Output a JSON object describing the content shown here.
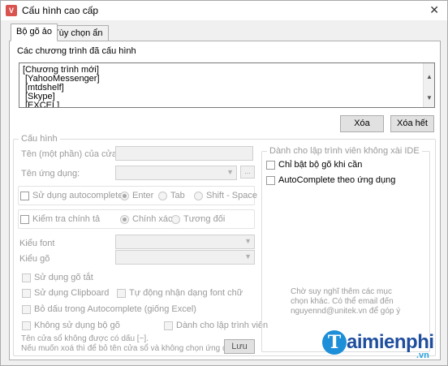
{
  "window": {
    "title": "Cấu hình cao cấp",
    "close_symbol": "✕"
  },
  "tabs": [
    {
      "label": "Bộ gõ ảo",
      "active": true
    },
    {
      "label": "Tùy chọn ẩn",
      "active": false
    }
  ],
  "programs": {
    "label": "Các chương trình đã cấu hình",
    "items": [
      "[Chương trình mới]",
      "[YahooMessenger]",
      "[mtdshelf]",
      "[Skype]",
      "[EXCEL]"
    ],
    "delete_label": "Xóa",
    "delete_all_label": "Xóa hết"
  },
  "config": {
    "group_label": "Cấu hình",
    "window_name_label": "Tên (một phần) của cửa sổ:",
    "window_name_value": "",
    "app_name_label": "Tên ứng dụng:",
    "app_name_value": "",
    "browse_label": "...",
    "use_autocomplete_label": "Sử dụng autocomplete",
    "autocomplete_options": [
      "Enter",
      "Tab",
      "Shift - Space"
    ],
    "autocomplete_selected": "Enter",
    "spellcheck_label": "Kiểm tra chính tả",
    "spellcheck_options": [
      "Chính xác",
      "Tương đối"
    ],
    "spellcheck_selected": "Chính xác",
    "font_type_label": "Kiểu font",
    "font_type_value": "",
    "input_type_label": "Kiểu gõ",
    "input_type_value": "",
    "use_shortcut_label": "Sử dụng gõ tắt",
    "use_clipboard_label": "Sử dụng Clipboard",
    "auto_font_detect_label": "Tự động nhận dạng font chữ",
    "remove_accent_label": "Bỏ dấu trong Autocomplete (giống Excel)",
    "no_ime_label": "Không sử dụng bộ gõ",
    "for_programmer_label": "Dành cho lập trình viên",
    "note_line1": "Tên cửa sổ không được có dấu [~].",
    "note_line2": "Nếu muốn xoá thì để bỏ tên cửa sổ và không chọn ứng dụng.",
    "save_label": "Lưu"
  },
  "dev": {
    "group_label": "Dành cho lập trình viên không xài IDE",
    "enable_only_when_needed_label": "Chỉ bật bộ gõ khi cần",
    "autocomplete_by_app_label": "AutoComplete theo ứng dụng",
    "hint_line1": "Chờ suy nghĩ thêm các mục",
    "hint_line2": "chọn khác. Có thể email đến",
    "hint_line3": "nguyennd@unitek.vn để góp ý"
  },
  "watermark": {
    "letter": "T",
    "name": "aimienphi",
    "tld": ".vn"
  },
  "colors": {
    "logo_blue": "#1f4e9e",
    "logo_circle": "#1d8fd8",
    "disabled_text": "#9a9a9a"
  }
}
